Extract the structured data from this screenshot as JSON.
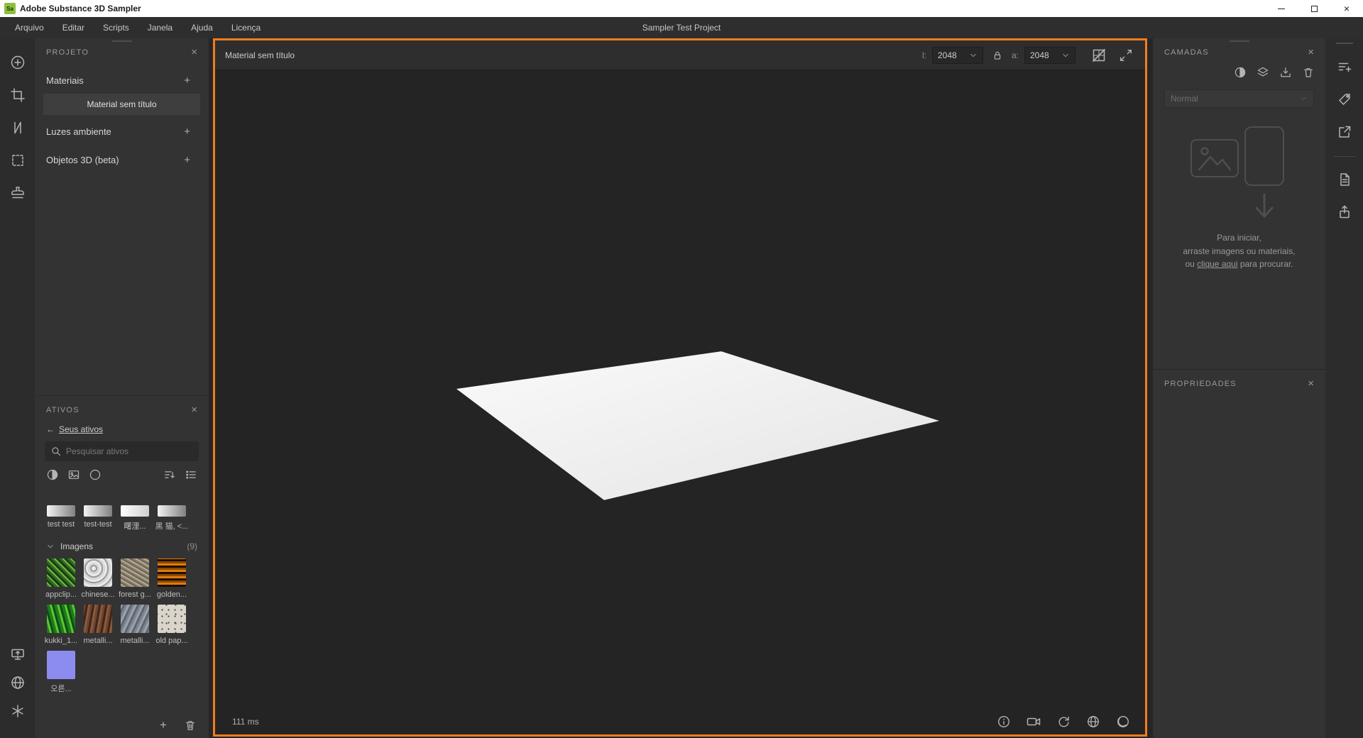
{
  "colors": {
    "accent_orange": "#EE7E1E",
    "app_icon_green": "#8FBF3F",
    "panel_bg": "#333333",
    "viewport_bg": "#242424"
  },
  "icons": {
    "close": "×",
    "plus": "+",
    "back_arrow": "←",
    "minimize": "–"
  },
  "titlebar": {
    "app_initials": "Sa",
    "title": "Adobe Substance 3D Sampler"
  },
  "menubar": {
    "items": [
      "Arquivo",
      "Editar",
      "Scripts",
      "Janela",
      "Ajuda",
      "Licença"
    ],
    "project_title": "Sampler Test Project"
  },
  "projeto": {
    "title": "PROJETO",
    "groups": [
      {
        "label": "Materiais"
      },
      {
        "label": "Luzes ambiente"
      },
      {
        "label": "Objetos 3D (beta)"
      }
    ],
    "selected_material": "Material sem título"
  },
  "ativos": {
    "title": "ATIVOS",
    "back_link": "Seus ativos",
    "search_placeholder": "Pesquisar ativos",
    "materials": [
      {
        "label": "test test"
      },
      {
        "label": "test-test"
      },
      {
        "label": "曙浬..."
      },
      {
        "label": "黑 猫, <..."
      }
    ],
    "images_section": {
      "label": "Imagens",
      "count": "(9)"
    },
    "images": [
      {
        "label": "appclip..."
      },
      {
        "label": "chinese..."
      },
      {
        "label": "forest g..."
      },
      {
        "label": "golden..."
      },
      {
        "label": "kukki_1..."
      },
      {
        "label": "metalli..."
      },
      {
        "label": "metalli..."
      },
      {
        "label": "old pap..."
      },
      {
        "label": "오른..."
      }
    ]
  },
  "viewport": {
    "title": "Material sem título",
    "width_label": "l:",
    "width_value": "2048",
    "height_label": "a:",
    "height_value": "2048",
    "render_time": "111 ms"
  },
  "camadas": {
    "title": "CAMADAS",
    "blend_mode": "Normal",
    "empty_line1": "Para iniciar,",
    "empty_line2": "arraste imagens ou materiais,",
    "empty_prefix": "ou ",
    "empty_link": "clique aqui",
    "empty_suffix": " para procurar."
  },
  "propriedades": {
    "title": "PROPRIEDADES"
  }
}
